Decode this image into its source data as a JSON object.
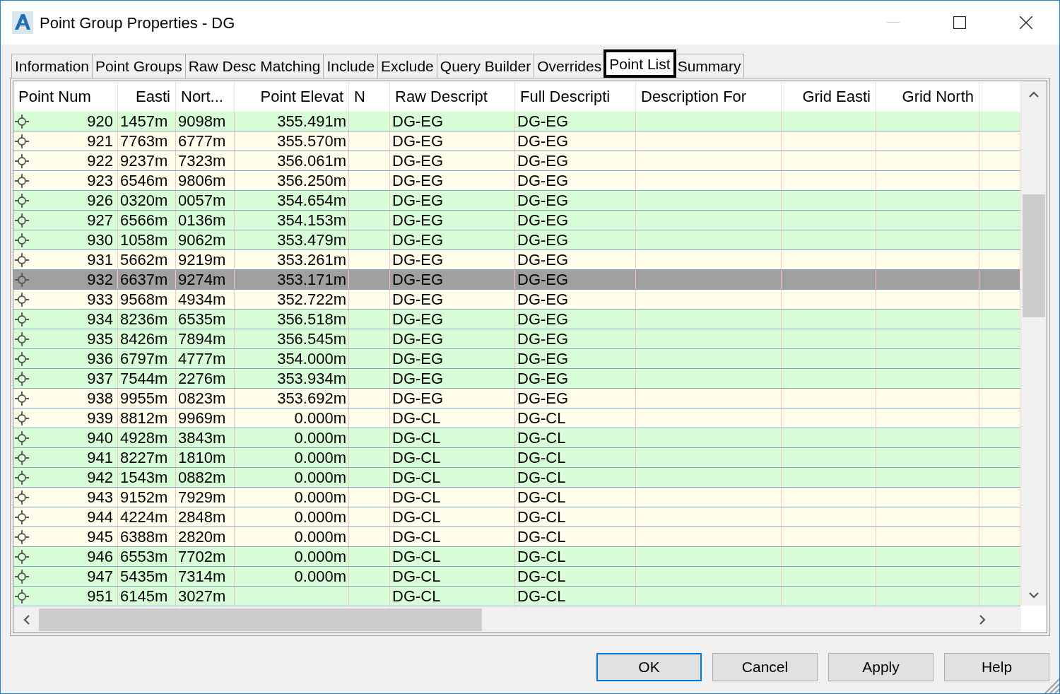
{
  "window": {
    "title": "Point Group Properties - DG"
  },
  "tabs": [
    {
      "label": "Information",
      "selected": false
    },
    {
      "label": "Point Groups",
      "selected": false
    },
    {
      "label": "Raw Desc Matching",
      "selected": false
    },
    {
      "label": "Include",
      "selected": false
    },
    {
      "label": "Exclude",
      "selected": false
    },
    {
      "label": "Query Builder",
      "selected": false
    },
    {
      "label": "Overrides",
      "selected": false
    },
    {
      "label": "Point List",
      "selected": true
    },
    {
      "label": "Summary",
      "selected": false
    }
  ],
  "table": {
    "columns": [
      "Point Num",
      "Easti",
      "Nort...",
      "Point Elevat",
      "N",
      "Raw Descript",
      "Full Descripti",
      "Description For",
      "Grid Easti",
      "Grid North"
    ],
    "rows": [
      {
        "point_num": "920",
        "easting": "1457m",
        "northing": "9098m",
        "elevation": "355.491m",
        "raw_description": "DG-EG",
        "full_description": "DG-EG",
        "color": "#d8fed8",
        "selected": false
      },
      {
        "point_num": "921",
        "easting": "7763m",
        "northing": "6777m",
        "elevation": "355.570m",
        "raw_description": "DG-EG",
        "full_description": "DG-EG",
        "color": "#fefeea",
        "selected": false
      },
      {
        "point_num": "922",
        "easting": "9237m",
        "northing": "7323m",
        "elevation": "356.061m",
        "raw_description": "DG-EG",
        "full_description": "DG-EG",
        "color": "#fefeea",
        "selected": false
      },
      {
        "point_num": "923",
        "easting": "6546m",
        "northing": "9806m",
        "elevation": "356.250m",
        "raw_description": "DG-EG",
        "full_description": "DG-EG",
        "color": "#fefeea",
        "selected": false
      },
      {
        "point_num": "926",
        "easting": "0320m",
        "northing": "0057m",
        "elevation": "354.654m",
        "raw_description": "DG-EG",
        "full_description": "DG-EG",
        "color": "#d8fed8",
        "selected": false
      },
      {
        "point_num": "927",
        "easting": "6566m",
        "northing": "0136m",
        "elevation": "354.153m",
        "raw_description": "DG-EG",
        "full_description": "DG-EG",
        "color": "#d8fed8",
        "selected": false
      },
      {
        "point_num": "930",
        "easting": "1058m",
        "northing": "9062m",
        "elevation": "353.479m",
        "raw_description": "DG-EG",
        "full_description": "DG-EG",
        "color": "#d8fed8",
        "selected": false
      },
      {
        "point_num": "931",
        "easting": "5662m",
        "northing": "9219m",
        "elevation": "353.261m",
        "raw_description": "DG-EG",
        "full_description": "DG-EG",
        "color": "#fefeea",
        "selected": false
      },
      {
        "point_num": "932",
        "easting": "6637m",
        "northing": "9274m",
        "elevation": "353.171m",
        "raw_description": "DG-EG",
        "full_description": "DG-EG",
        "selected": true
      },
      {
        "point_num": "933",
        "easting": "9568m",
        "northing": "4934m",
        "elevation": "352.722m",
        "raw_description": "DG-EG",
        "full_description": "DG-EG",
        "color": "#fefeea",
        "selected": false
      },
      {
        "point_num": "934",
        "easting": "8236m",
        "northing": "6535m",
        "elevation": "356.518m",
        "raw_description": "DG-EG",
        "full_description": "DG-EG",
        "color": "#d8fed8",
        "selected": false
      },
      {
        "point_num": "935",
        "easting": "8426m",
        "northing": "7894m",
        "elevation": "356.545m",
        "raw_description": "DG-EG",
        "full_description": "DG-EG",
        "color": "#d8fed8",
        "selected": false
      },
      {
        "point_num": "936",
        "easting": "6797m",
        "northing": "4777m",
        "elevation": "354.000m",
        "raw_description": "DG-EG",
        "full_description": "DG-EG",
        "color": "#d8fed8",
        "selected": false
      },
      {
        "point_num": "937",
        "easting": "7544m",
        "northing": "2276m",
        "elevation": "353.934m",
        "raw_description": "DG-EG",
        "full_description": "DG-EG",
        "color": "#d8fed8",
        "selected": false
      },
      {
        "point_num": "938",
        "easting": "9955m",
        "northing": "0823m",
        "elevation": "353.692m",
        "raw_description": "DG-EG",
        "full_description": "DG-EG",
        "color": "#fefeea",
        "selected": false
      },
      {
        "point_num": "939",
        "easting": "8812m",
        "northing": "9969m",
        "elevation": "0.000m",
        "raw_description": "DG-CL",
        "full_description": "DG-CL",
        "color": "#fefeea",
        "selected": false
      },
      {
        "point_num": "940",
        "easting": "4928m",
        "northing": "3843m",
        "elevation": "0.000m",
        "raw_description": "DG-CL",
        "full_description": "DG-CL",
        "color": "#d8fed8",
        "selected": false
      },
      {
        "point_num": "941",
        "easting": "8227m",
        "northing": "1810m",
        "elevation": "0.000m",
        "raw_description": "DG-CL",
        "full_description": "DG-CL",
        "color": "#d8fed8",
        "selected": false
      },
      {
        "point_num": "942",
        "easting": "1543m",
        "northing": "0882m",
        "elevation": "0.000m",
        "raw_description": "DG-CL",
        "full_description": "DG-CL",
        "color": "#d8fed8",
        "selected": false
      },
      {
        "point_num": "943",
        "easting": "9152m",
        "northing": "7929m",
        "elevation": "0.000m",
        "raw_description": "DG-CL",
        "full_description": "DG-CL",
        "color": "#fefeea",
        "selected": false
      },
      {
        "point_num": "944",
        "easting": "4224m",
        "northing": "2848m",
        "elevation": "0.000m",
        "raw_description": "DG-CL",
        "full_description": "DG-CL",
        "color": "#fefeea",
        "selected": false
      },
      {
        "point_num": "945",
        "easting": "6388m",
        "northing": "2820m",
        "elevation": "0.000m",
        "raw_description": "DG-CL",
        "full_description": "DG-CL",
        "color": "#fefeea",
        "selected": false
      },
      {
        "point_num": "946",
        "easting": "6553m",
        "northing": "7702m",
        "elevation": "0.000m",
        "raw_description": "DG-CL",
        "full_description": "DG-CL",
        "color": "#d8fed8",
        "selected": false
      },
      {
        "point_num": "947",
        "easting": "5435m",
        "northing": "7314m",
        "elevation": "0.000m",
        "raw_description": "DG-CL",
        "full_description": "DG-CL",
        "color": "#d8fed8",
        "selected": false
      },
      {
        "point_num": "951",
        "easting": "6145m",
        "northing": "3027m",
        "raw_description": "DG-CL",
        "full_description": "DG-CL",
        "color": "#d8fed8",
        "selected": false
      }
    ]
  },
  "buttons": [
    {
      "label": "OK",
      "kind": "default"
    },
    {
      "label": "Cancel",
      "kind": "normal"
    },
    {
      "label": "Apply",
      "kind": "normal"
    },
    {
      "label": "Help",
      "kind": "normal"
    }
  ]
}
